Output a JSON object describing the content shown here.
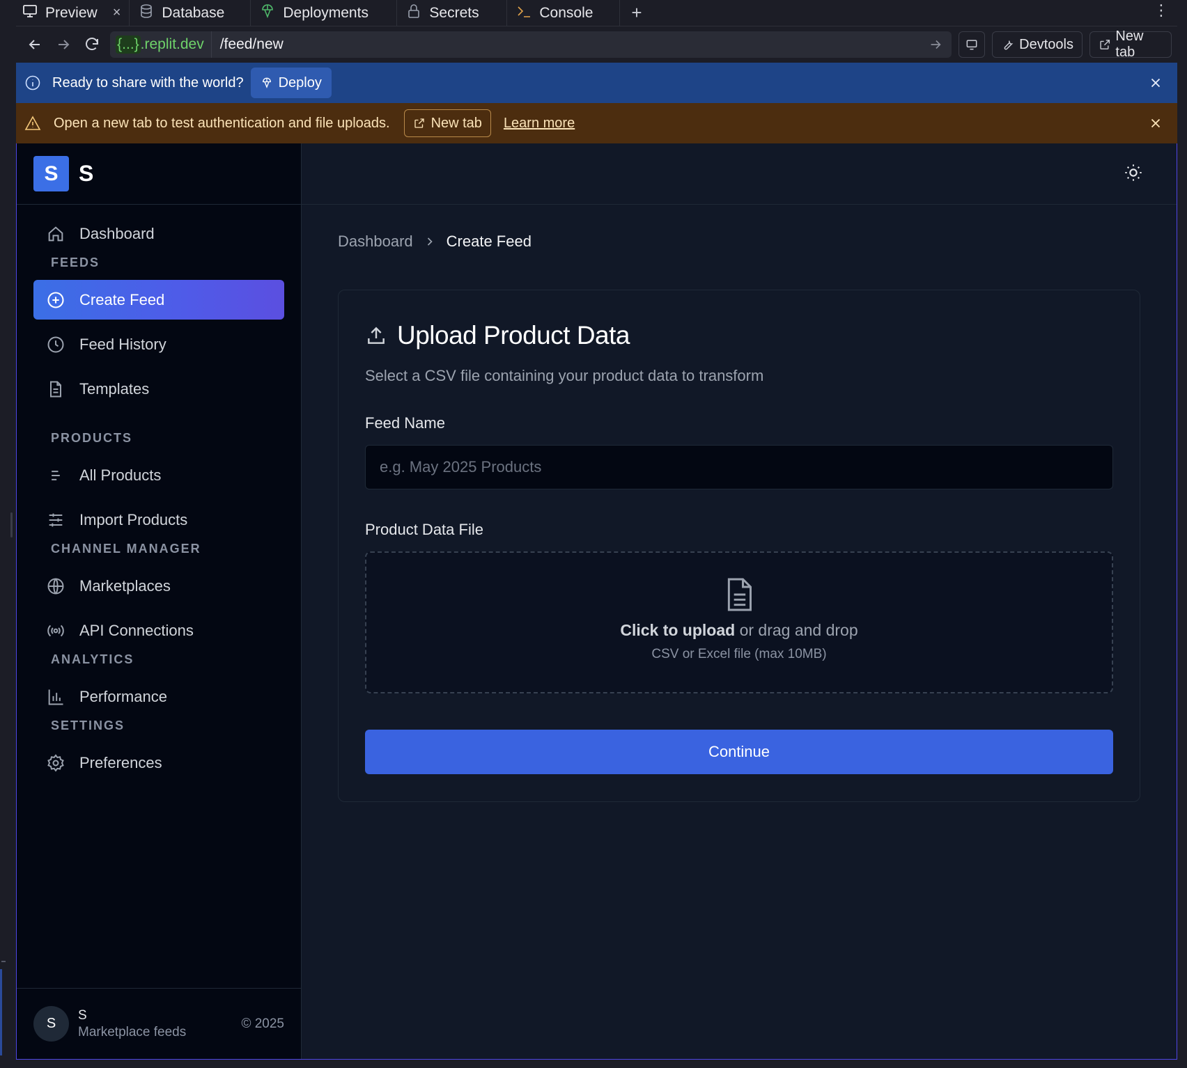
{
  "browser": {
    "tabs": [
      {
        "label": "Preview",
        "icon": "monitor-icon",
        "close": "×"
      },
      {
        "label": "Database",
        "icon": "database-icon"
      },
      {
        "label": "Deployments",
        "icon": "deploy-icon"
      },
      {
        "label": "Secrets",
        "icon": "lock-icon"
      },
      {
        "label": "Console",
        "icon": "terminal-icon"
      }
    ],
    "new_tab_glyph": "+",
    "menu_glyph": "⋮",
    "url_host_braces": "{...}",
    "url_host": ".replit.dev",
    "url_path": "/feed/new",
    "devtools_label": "Devtools",
    "new_tab_label": "New tab"
  },
  "banners": {
    "deploy": {
      "text": "Ready to share with the world?",
      "button": "Deploy"
    },
    "auth": {
      "text": "Open a new tab to test authentication and file uploads.",
      "button": "New tab",
      "link": "Learn more"
    }
  },
  "sidebar": {
    "brand_logo": "S",
    "brand_name": "S",
    "dashboard": "Dashboard",
    "sections": {
      "feeds": "FEEDS",
      "products": "PRODUCTS",
      "channel_manager": "CHANNEL MANAGER",
      "analytics": "ANALYTICS",
      "settings": "SETTINGS"
    },
    "items": {
      "create_feed": "Create Feed",
      "feed_history": "Feed History",
      "templates": "Templates",
      "all_products": "All Products",
      "import_products": "Import Products",
      "marketplaces": "Marketplaces",
      "api_connections": "API Connections",
      "performance": "Performance",
      "preferences": "Preferences"
    },
    "footer": {
      "avatar": "S",
      "name": "S",
      "subtitle": "Marketplace feeds",
      "copyright": "© 2025"
    }
  },
  "main": {
    "breadcrumb": {
      "parent": "Dashboard",
      "current": "Create Feed"
    },
    "card": {
      "title": "Upload Product Data",
      "description": "Select a CSV file containing your product data to transform",
      "feed_name_label": "Feed Name",
      "feed_name_placeholder": "e.g. May 2025 Products",
      "feed_name_value": "",
      "file_label": "Product Data File",
      "dropzone_strong": "Click to upload",
      "dropzone_rest": " or drag and drop",
      "dropzone_hint": "CSV or Excel file (max 10MB)",
      "continue": "Continue"
    }
  },
  "colors": {
    "accent": "#3a63e0",
    "sidebar_bg": "#030712",
    "main_bg": "#111827",
    "banner_blue": "#1e4487",
    "banner_amber": "#4c2d0f",
    "url_green": "#6fd36a"
  }
}
